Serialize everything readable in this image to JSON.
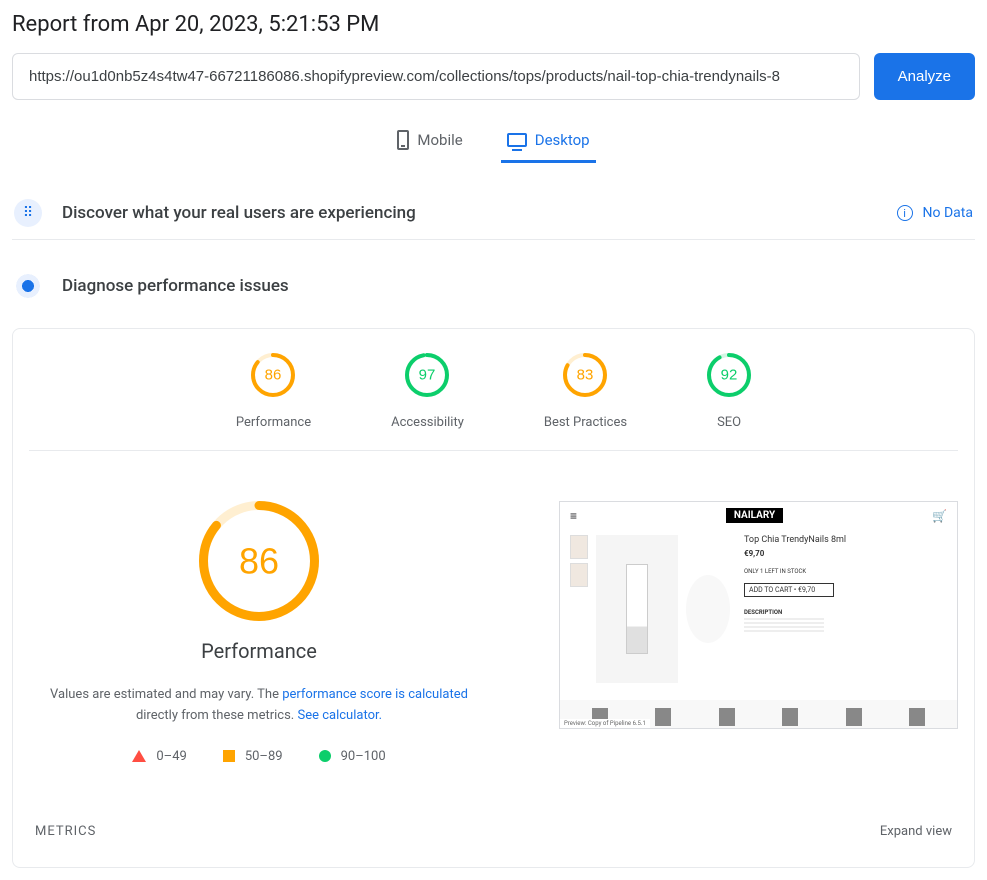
{
  "title": "Report from Apr 20, 2023, 5:21:53 PM",
  "url": "https://ou1d0nb5z4s4tw47-66721186086.shopifypreview.com/collections/tops/products/nail-top-chia-trendynails-8",
  "analyze": "Analyze",
  "tabs": {
    "mobile": "Mobile",
    "desktop": "Desktop"
  },
  "crux": {
    "title": "Discover what your real users are experiencing",
    "nodata": "No Data"
  },
  "diag": {
    "title": "Diagnose performance issues"
  },
  "scores": [
    {
      "label": "Performance",
      "value": 86,
      "color": "#ffa400"
    },
    {
      "label": "Accessibility",
      "value": 97,
      "color": "#0cce6b"
    },
    {
      "label": "Best Practices",
      "value": 83,
      "color": "#ffa400"
    },
    {
      "label": "SEO",
      "value": 92,
      "color": "#0cce6b"
    }
  ],
  "detail": {
    "score": 86,
    "color": "#ffa400",
    "title": "Performance",
    "text1": "Values are estimated and may vary. The ",
    "link1": "performance score is calculated",
    "text2": " directly from these metrics. ",
    "link2": "See calculator."
  },
  "legend": {
    "r1": "0–49",
    "r2": "50–89",
    "r3": "90–100"
  },
  "preview": {
    "brand": "NAILARY",
    "ptitle": "Top Chia TrendyNails 8ml",
    "price": "€9,70",
    "stock": "ONLY 1 LEFT IN STOCK",
    "cart": "ADD TO CART  •  €9,70",
    "desc": "DESCRIPTION"
  },
  "metrics": {
    "label": "METRICS",
    "expand": "Expand view"
  },
  "chart_data": {
    "type": "gauge",
    "series": [
      {
        "name": "Performance",
        "value": 86,
        "range": [
          0,
          100
        ]
      },
      {
        "name": "Accessibility",
        "value": 97,
        "range": [
          0,
          100
        ]
      },
      {
        "name": "Best Practices",
        "value": 83,
        "range": [
          0,
          100
        ]
      },
      {
        "name": "SEO",
        "value": 92,
        "range": [
          0,
          100
        ]
      }
    ]
  }
}
